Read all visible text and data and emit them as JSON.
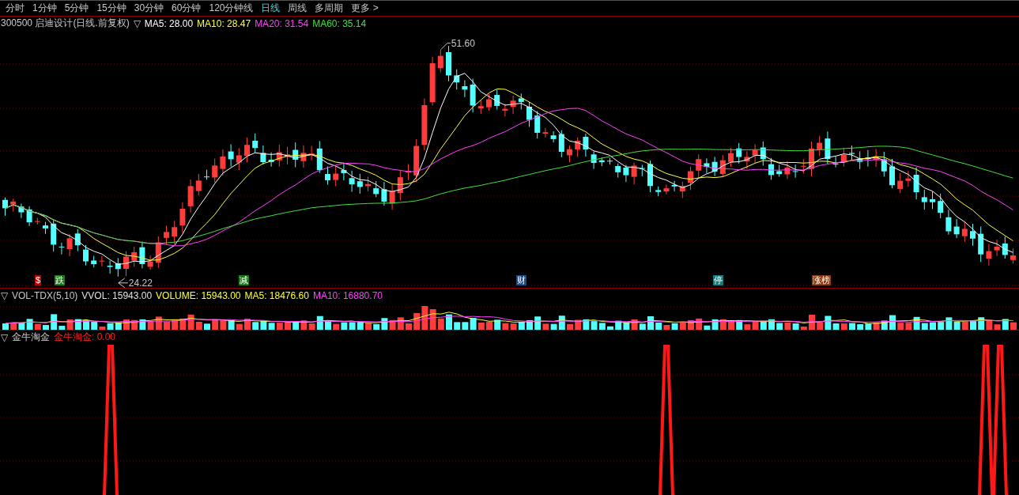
{
  "toolbar": {
    "items": [
      {
        "label": "分时",
        "selected": false
      },
      {
        "label": "1分钟",
        "selected": false
      },
      {
        "label": "5分钟",
        "selected": false
      },
      {
        "label": "15分钟",
        "selected": false
      },
      {
        "label": "30分钟",
        "selected": false
      },
      {
        "label": "60分钟",
        "selected": false
      },
      {
        "label": "120分钟线",
        "selected": false
      },
      {
        "label": "日线",
        "selected": true
      },
      {
        "label": "周线",
        "selected": false
      },
      {
        "label": "多周期",
        "selected": false
      },
      {
        "label": "更多 >",
        "selected": false
      }
    ]
  },
  "main_panel": {
    "toggle": "▽",
    "title": "300500 启迪设计(日线.前复权)",
    "indicators": [
      {
        "label": "MA5: 28.00",
        "color": "#ffffff"
      },
      {
        "label": "MA10: 28.47",
        "color": "#ffff40"
      },
      {
        "label": "MA20: 31.54",
        "color": "#ff40ff"
      },
      {
        "label": "MA60: 35.14",
        "color": "#40e040"
      }
    ],
    "high_label": "51.60",
    "low_label": "24.22",
    "events": [
      {
        "label": "$",
        "color": "#c00000"
      },
      {
        "label": "跌",
        "color": "#1a7a1a"
      },
      {
        "label": "减",
        "color": "#1a7a1a"
      },
      {
        "label": "财",
        "color": "#1a4a8a"
      },
      {
        "label": "停",
        "color": "#157a7a"
      },
      {
        "label": "涨榜",
        "color": "#8a3a10"
      }
    ]
  },
  "volume_panel": {
    "toggle": "▽",
    "name": "VOL-TDX(5,10)",
    "readings": [
      {
        "label": "VVOL: 15943.00",
        "color": "#e0e0e0"
      },
      {
        "label": "VOLUME: 15943.00",
        "color": "#ffff40"
      },
      {
        "label": "MA5: 18476.60",
        "color": "#ffff40"
      },
      {
        "label": "MA10: 16880.70",
        "color": "#ff40ff"
      }
    ]
  },
  "signal_panel": {
    "toggle": "▽",
    "name": "金牛淘金",
    "readings": [
      {
        "label": "金牛淘金: 0.00"
      }
    ]
  }
}
